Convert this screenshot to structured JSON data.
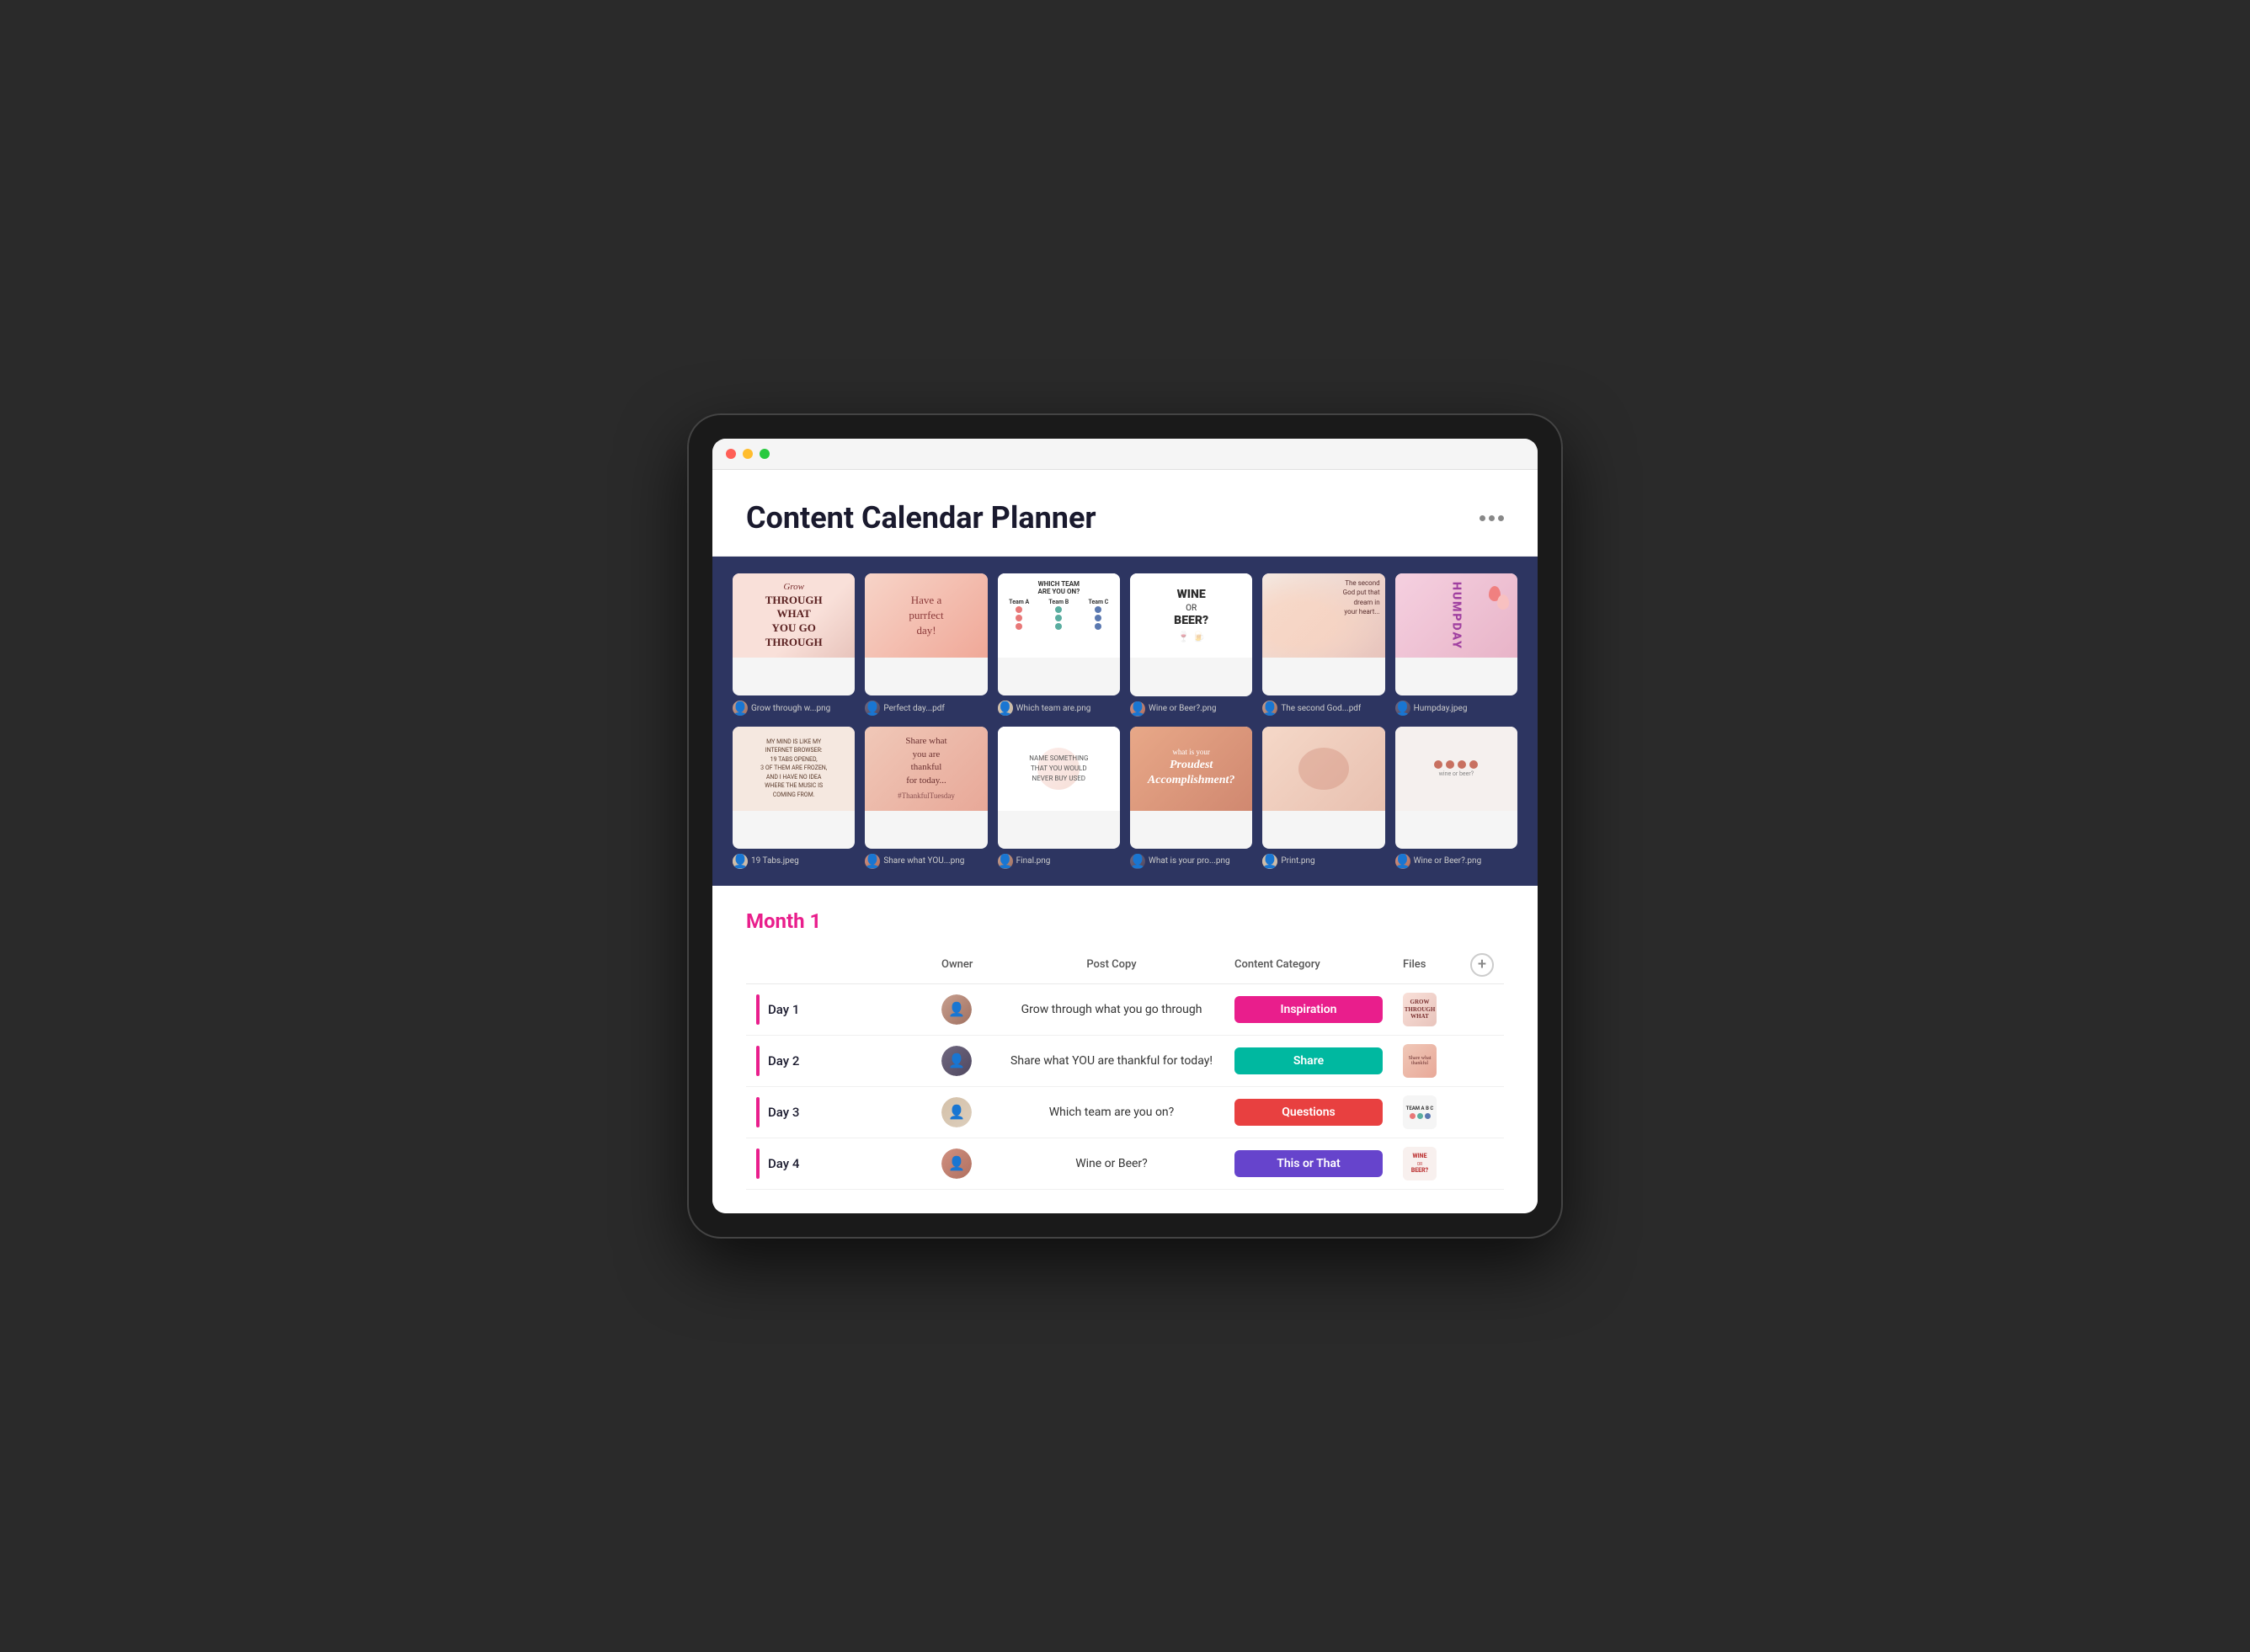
{
  "device": {
    "traffic_lights": [
      "red",
      "yellow",
      "green"
    ]
  },
  "header": {
    "title": "Content Calendar Planner",
    "more_icon": "···"
  },
  "gallery": {
    "row1": [
      {
        "filename": "Grow through w...png",
        "thumb_type": "grow"
      },
      {
        "filename": "Perfect day...pdf",
        "thumb_type": "purrfect"
      },
      {
        "filename": "Which team are.png",
        "thumb_type": "teams"
      },
      {
        "filename": "Wine or Beer?.png",
        "thumb_type": "wine"
      },
      {
        "filename": "The second God...pdf",
        "thumb_type": "flower"
      },
      {
        "filename": "Humpday.jpeg",
        "thumb_type": "humpday"
      }
    ],
    "row2": [
      {
        "filename": "19 Tabs.jpeg",
        "thumb_type": "tabs"
      },
      {
        "filename": "Share what YOU...png",
        "thumb_type": "thankful"
      },
      {
        "filename": "Final.png",
        "thumb_type": "final"
      },
      {
        "filename": "What is your pro...png",
        "thumb_type": "proudest"
      },
      {
        "filename": "Print.png",
        "thumb_type": "print"
      },
      {
        "filename": "Wine or Beer?.png",
        "thumb_type": "wine2"
      }
    ]
  },
  "planner": {
    "month_label": "Month 1",
    "columns": {
      "owner": "Owner",
      "post_copy": "Post Copy",
      "content_category": "Content Category",
      "files": "Files",
      "add": "+"
    },
    "rows": [
      {
        "day": "Day 1",
        "post_copy": "Grow through what you go through",
        "category": "Inspiration",
        "category_class": "cat-inspiration",
        "file_class": "ft-grow"
      },
      {
        "day": "Day 2",
        "post_copy": "Share what YOU are thankful for today!",
        "category": "Share",
        "category_class": "cat-share",
        "file_class": "ft-thankful"
      },
      {
        "day": "Day 3",
        "post_copy": "Which team are you on?",
        "category": "Questions",
        "category_class": "cat-questions",
        "file_class": "ft-teams"
      },
      {
        "day": "Day 4",
        "post_copy": "Wine or Beer?",
        "category": "This or That",
        "category_class": "cat-this-or-that",
        "file_class": "ft-wine"
      }
    ]
  }
}
